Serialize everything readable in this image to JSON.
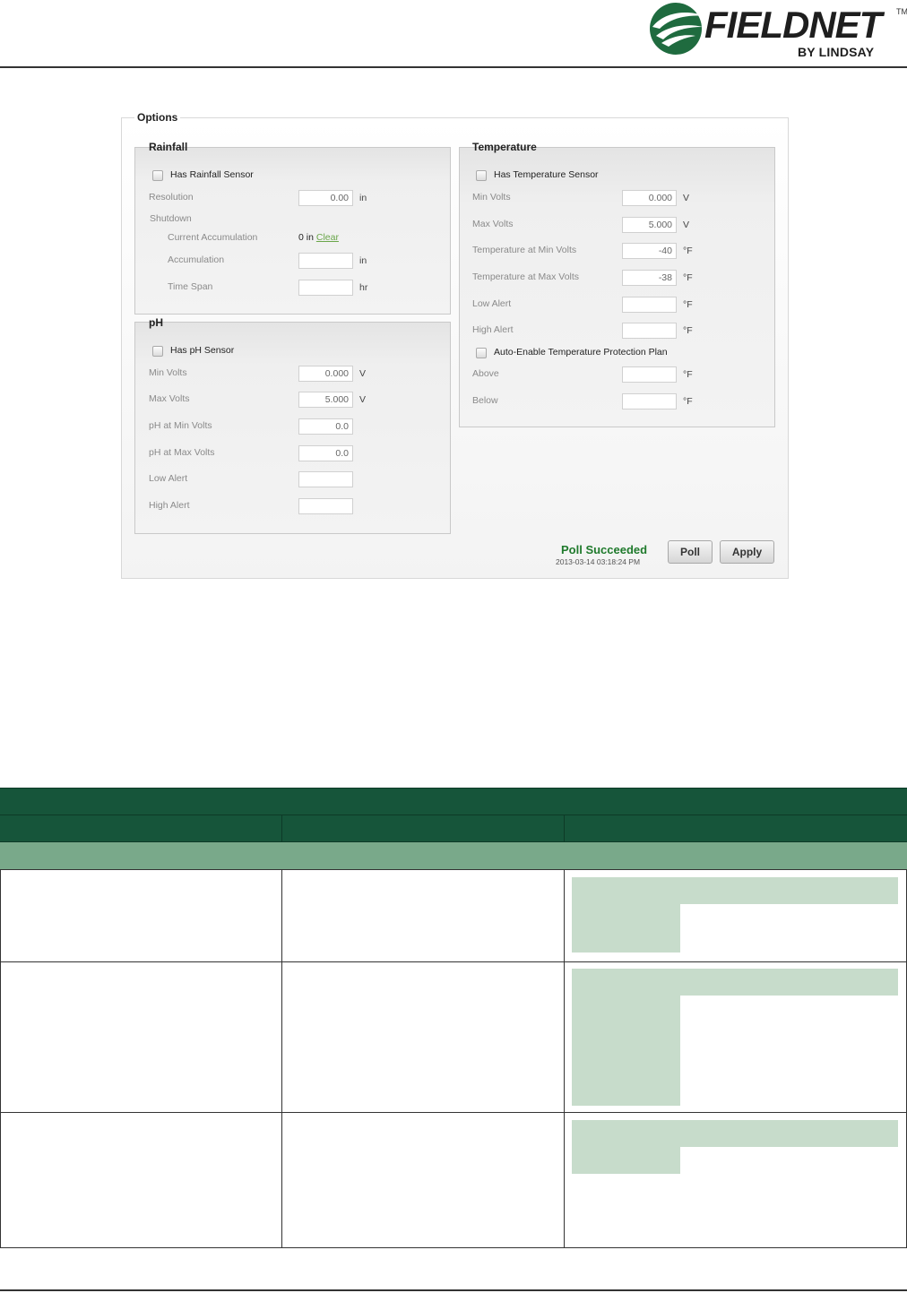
{
  "header": {
    "brand": "FIELDNET",
    "trademark": "TM",
    "brand_sub": "BY LINDSAY"
  },
  "colors": {
    "brand_green": "#16553a",
    "subheader_green": "#79a98a",
    "shade_green": "#c7dccb",
    "status_green": "#1f7a2c",
    "link_green": "#6aa64a"
  },
  "options": {
    "title": "Options",
    "rainfall": {
      "title": "Rainfall",
      "has_sensor_label": "Has Rainfall Sensor",
      "resolution_label": "Resolution",
      "resolution_value": "0.00",
      "resolution_unit": "in",
      "shutdown_label": "Shutdown",
      "current_accum_label": "Current Accumulation",
      "current_accum_value": "0 in",
      "clear_link": "Clear",
      "accumulation_label": "Accumulation",
      "accumulation_unit": "in",
      "time_span_label": "Time Span",
      "time_span_unit": "hr"
    },
    "ph": {
      "title": "pH",
      "has_sensor_label": "Has pH Sensor",
      "min_volts_label": "Min Volts",
      "min_volts_value": "0.000",
      "max_volts_label": "Max Volts",
      "max_volts_value": "5.000",
      "volts_unit": "V",
      "ph_min_label": "pH at Min Volts",
      "ph_min_value": "0.0",
      "ph_max_label": "pH at Max Volts",
      "ph_max_value": "0.0",
      "low_alert_label": "Low Alert",
      "high_alert_label": "High Alert"
    },
    "temperature": {
      "title": "Temperature",
      "has_sensor_label": "Has Temperature Sensor",
      "min_volts_label": "Min Volts",
      "min_volts_value": "0.000",
      "max_volts_label": "Max Volts",
      "max_volts_value": "5.000",
      "volts_unit": "V",
      "temp_min_label": "Temperature at Min Volts",
      "temp_min_value": "-40",
      "temp_max_label": "Temperature at Max Volts",
      "temp_max_value": "-38",
      "temp_unit": "°F",
      "low_alert_label": "Low Alert",
      "high_alert_label": "High Alert",
      "auto_enable_label": "Auto-Enable Temperature Protection Plan",
      "above_label": "Above",
      "below_label": "Below"
    },
    "status_text": "Poll Succeeded",
    "status_timestamp": "2013-03-14 03:18:24 PM",
    "poll_button": "Poll",
    "apply_button": "Apply"
  }
}
